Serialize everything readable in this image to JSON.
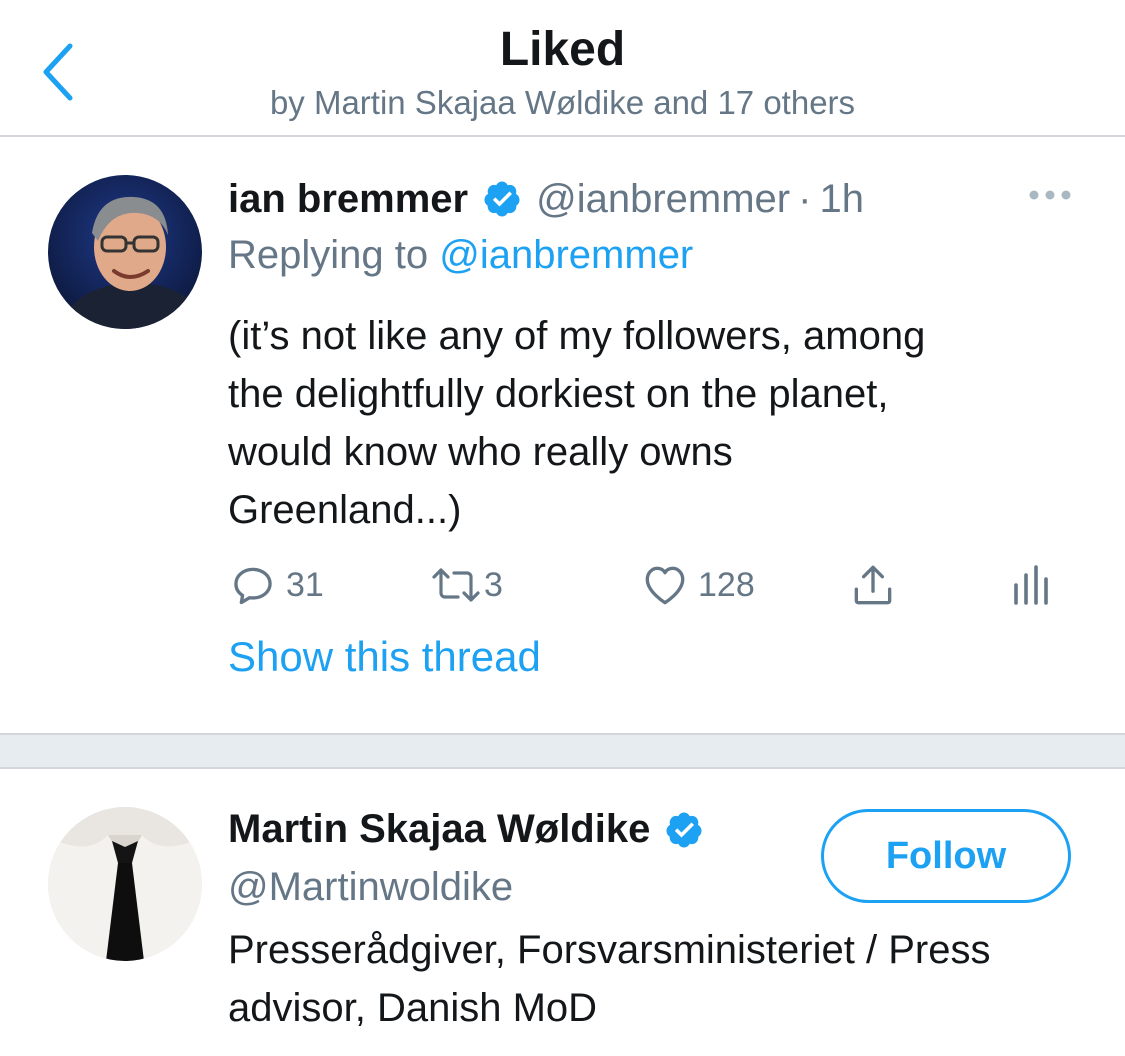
{
  "header": {
    "title": "Liked",
    "subtitle": "by Martin Skajaa Wøldike and 17 others",
    "back_icon": "chevron-left-icon"
  },
  "tweet": {
    "author_name": "ian bremmer",
    "author_handle": "@ianbremmer",
    "separator": "·",
    "time": "1h",
    "replying_prefix": "Replying to",
    "replying_to": "@ianbremmer",
    "text": "(it’s not like any of my followers, among\nthe delightfully dorkiest on the planet,\nwould know who really owns\nGreenland...)",
    "actions": {
      "reply_count": "31",
      "retweet_count": "3",
      "like_count": "128"
    },
    "show_thread": "Show this thread"
  },
  "user_cell": {
    "name": "Martin Skajaa Wøldike",
    "handle": "@Martinwoldike",
    "bio": "Presserådgiver, Forsvarsministeriet / Press advisor, Danish MoD",
    "follow_label": "Follow"
  },
  "colors": {
    "accent": "#1da1f2",
    "secondary_text": "#657786",
    "primary_text": "#14171a",
    "separator": "#e6ecf0"
  }
}
